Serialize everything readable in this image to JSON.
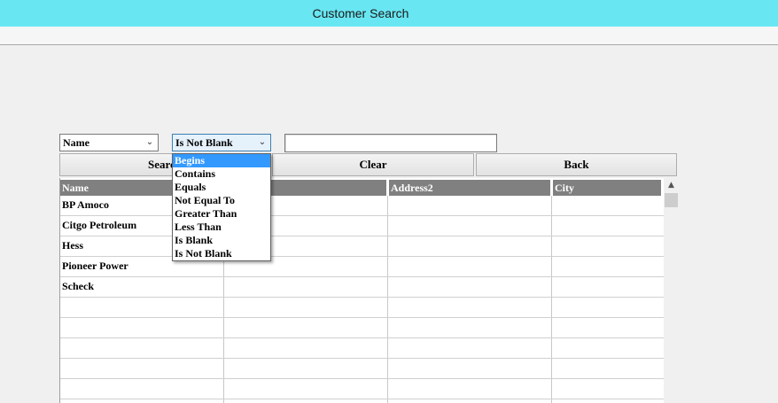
{
  "window": {
    "title": "Customer Search"
  },
  "filter": {
    "field_selected": "Name",
    "operator_selected": "Is Not Blank",
    "value": "",
    "operator_options": [
      "Begins",
      "Contains",
      "Equals",
      "Not Equal To",
      "Greater Than",
      "Less Than",
      "Is Blank",
      "Is Not Blank"
    ],
    "highlighted_option": "Begins"
  },
  "buttons": {
    "search": "Search",
    "clear": "Clear",
    "back": "Back"
  },
  "table": {
    "columns": [
      "Name",
      "Address1",
      "Address2",
      "City"
    ],
    "rows": [
      "BP Amoco",
      "Citgo Petroleum",
      "Hess",
      "Pioneer Power",
      "Scheck"
    ]
  },
  "colors": {
    "titlebar": "#68e6f2",
    "header": "#808080",
    "highlight": "#3399ff"
  }
}
